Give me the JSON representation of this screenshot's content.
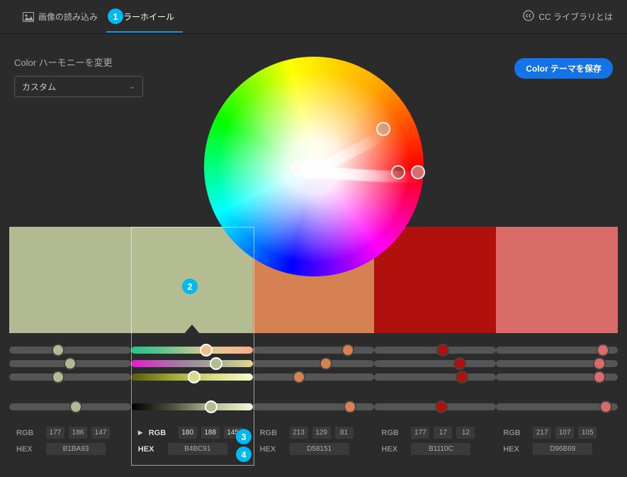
{
  "tabs": {
    "import_image": "画像の読み込み",
    "color_wheel": "カラーホイール"
  },
  "cc_link": "CC ライブラリとは",
  "harmony": {
    "label": "Color ハーモニーを変更",
    "value": "カスタム"
  },
  "save_button": "Color テーマを保存",
  "swatches": [
    {
      "hex": "B1BA93",
      "rgb": [
        177,
        186,
        147
      ],
      "sliders": {
        "hue": 40,
        "sat": 50,
        "lig": 40,
        "val": 55
      },
      "knob_colors": {
        "hue": "#b1ba93",
        "sat": "#b1ba93",
        "lig": "#b1ba93",
        "val": "#b1ba93"
      }
    },
    {
      "hex": "B4BC91",
      "rgb": [
        180,
        188,
        145
      ],
      "sliders": {
        "hue": 62,
        "sat": 70,
        "lig": 52,
        "val": 66
      },
      "knob_colors": {
        "hue": "#eec090",
        "sat": "#b4bc91",
        "lig": "#d6dc88",
        "val": "#b4bc91"
      }
    },
    {
      "hex": "D58151",
      "rgb": [
        213,
        129,
        81
      ],
      "sliders": {
        "hue": 78,
        "sat": 60,
        "lig": 38,
        "val": 80
      },
      "knob_colors": {
        "hue": "#d58151",
        "sat": "#d58151",
        "lig": "#d58151",
        "val": "#d58151"
      }
    },
    {
      "hex": "B1110C",
      "rgb": [
        177,
        17,
        12
      ],
      "sliders": {
        "hue": 56,
        "sat": 70,
        "lig": 72,
        "val": 55
      },
      "knob_colors": {
        "hue": "#b1110c",
        "sat": "#b1110c",
        "lig": "#b1110c",
        "val": "#b1110c"
      }
    },
    {
      "hex": "D96B69",
      "rgb": [
        217,
        107,
        105
      ],
      "sliders": {
        "hue": 88,
        "sat": 85,
        "lig": 85,
        "val": 90
      },
      "knob_colors": {
        "hue": "#d96b69",
        "sat": "#d96b69",
        "lig": "#d96b69",
        "val": "#d96b69"
      }
    }
  ],
  "selected_index": 1,
  "labels": {
    "rgb": "RGB",
    "hex": "HEX"
  },
  "wheel_markers": [
    {
      "color": "#b4bc91",
      "angle": 174,
      "radius": 22
    },
    {
      "color": "#d58151",
      "angle": -28,
      "radius": 112
    },
    {
      "color": "#b1110c",
      "angle": 4,
      "radius": 120
    },
    {
      "color": "#d96b69",
      "angle": 3,
      "radius": 148
    },
    {
      "color": "#b1ba93",
      "angle": 174,
      "radius": 22
    }
  ],
  "callouts": {
    "1": "1",
    "2": "2",
    "3": "3",
    "4": "4"
  }
}
